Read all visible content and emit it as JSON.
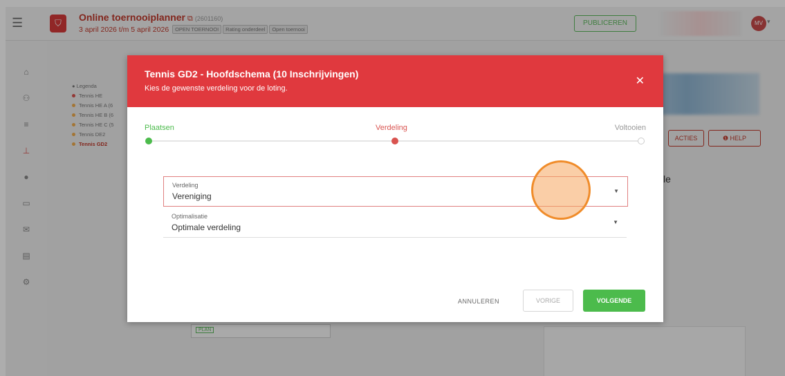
{
  "app": {
    "title": "Online toernooiplanner",
    "id": "(2601160)",
    "dates": "3 april 2026 t/m 5 april 2026",
    "badges": [
      "OPEN TOERNOOI",
      "Rating onderdeel",
      "Open toernooi"
    ],
    "publish_label": "PUBLICEREN",
    "user_initials": "MV"
  },
  "legend": {
    "title": "Legenda",
    "items": [
      {
        "label": "Tennis HE",
        "color": "#d9534f"
      },
      {
        "label": "Tennis HE A (6",
        "color": "#f0ad4e"
      },
      {
        "label": "Tennis HE B (6",
        "color": "#f0ad4e"
      },
      {
        "label": "Tennis HE C (5",
        "color": "#f0ad4e"
      },
      {
        "label": "Tennis DE2",
        "color": "#f0ad4e"
      },
      {
        "label": "Tennis GD2",
        "color": "#f0ad4e"
      }
    ]
  },
  "background": {
    "acties_label": "ACTIES",
    "help_label": "HELP",
    "heading_fragment": "le",
    "plan_label": "PLAN"
  },
  "modal": {
    "title": "Tennis GD2 - Hoofdschema (10 Inschrijvingen)",
    "subtitle": "Kies de gewenste verdeling voor de loting.",
    "steps": [
      {
        "label": "Plaatsen",
        "state": "done",
        "color": "#4cbb4c"
      },
      {
        "label": "Verdeling",
        "state": "active",
        "color": "#d9534f"
      },
      {
        "label": "Voltooien",
        "state": "todo",
        "color": "#999999"
      }
    ],
    "fields": [
      {
        "label": "Verdeling",
        "value": "Vereniging"
      },
      {
        "label": "Optimalisatie",
        "value": "Optimale verdeling"
      }
    ],
    "buttons": {
      "cancel": "ANNULEREN",
      "previous": "VORIGE",
      "next": "VOLGENDE"
    }
  }
}
